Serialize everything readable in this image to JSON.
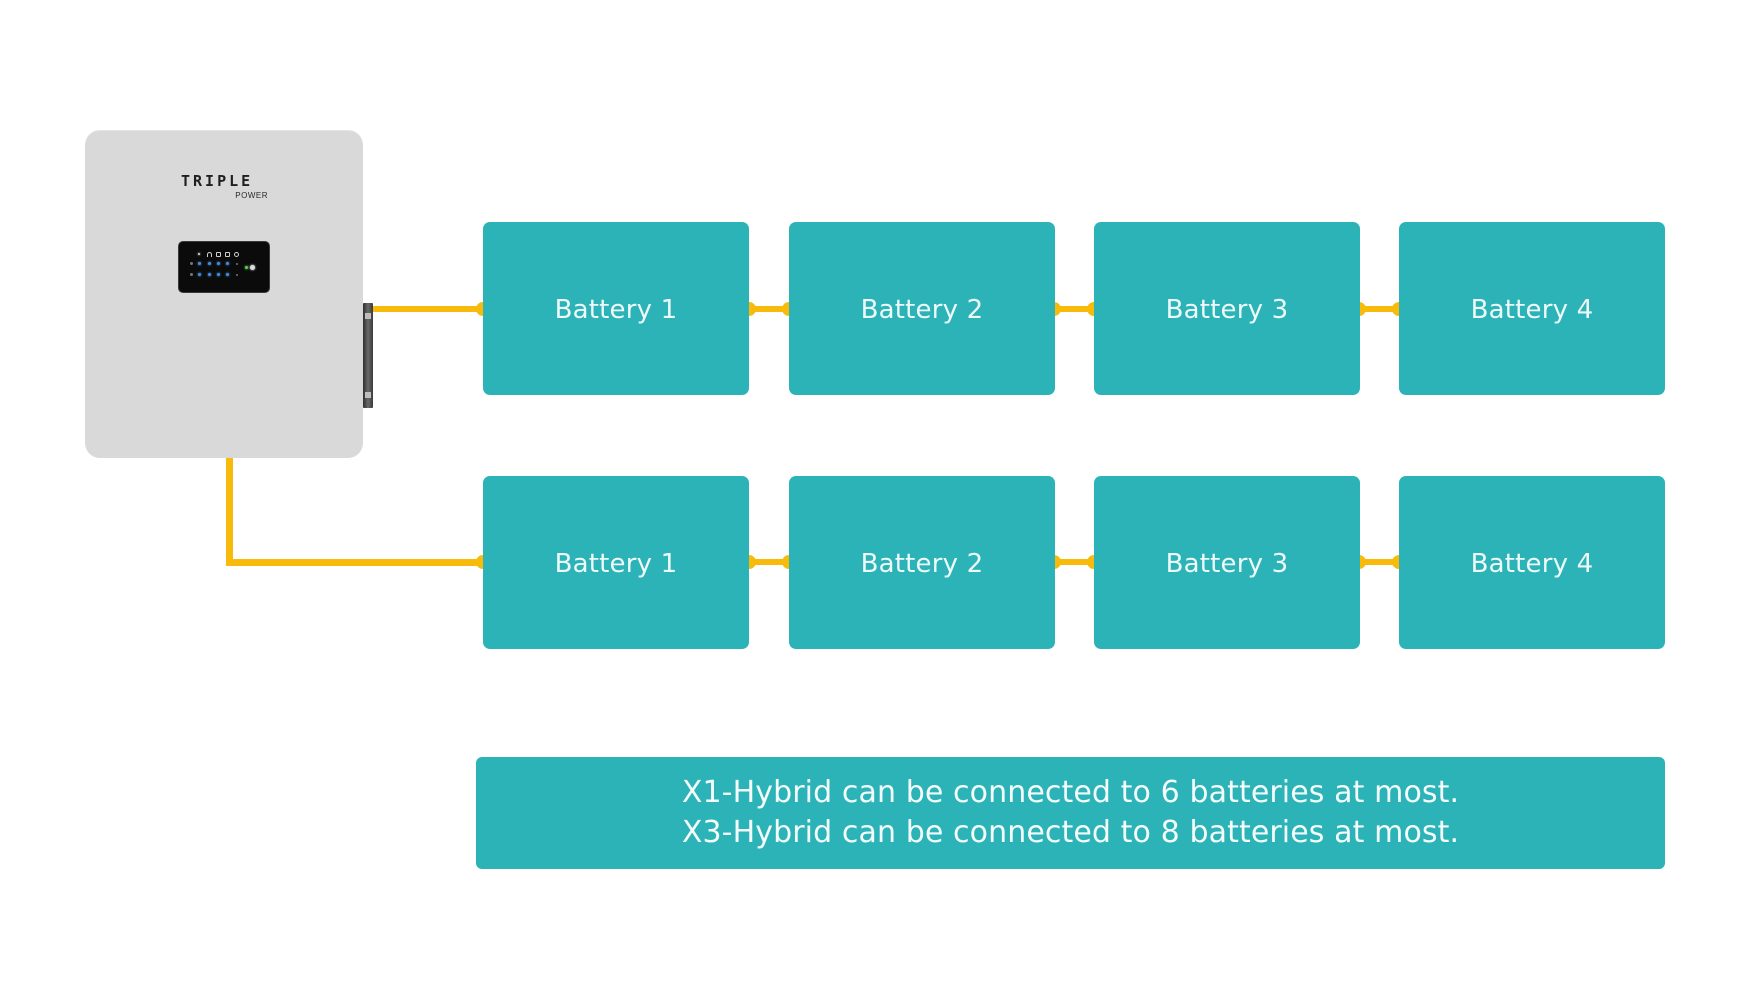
{
  "diagram": {
    "inverter": {
      "brand_main": "TRIPLE",
      "brand_sub": "POWER"
    },
    "rows": [
      {
        "batteries": [
          {
            "label": "Battery 1"
          },
          {
            "label": "Battery 2"
          },
          {
            "label": "Battery 3"
          },
          {
            "label": "Battery 4"
          }
        ]
      },
      {
        "batteries": [
          {
            "label": "Battery 1"
          },
          {
            "label": "Battery 2"
          },
          {
            "label": "Battery 3"
          },
          {
            "label": "Battery 4"
          }
        ]
      }
    ],
    "note": {
      "line1": "X1-Hybrid can be connected to 6 batteries at most.",
      "line2": "X3-Hybrid can be connected to 8 batteries at most."
    },
    "colors": {
      "battery": "#2bb3b8",
      "cable": "#f8bb0b",
      "inverter": "#d9d9d9",
      "background": "#ffffff"
    }
  }
}
